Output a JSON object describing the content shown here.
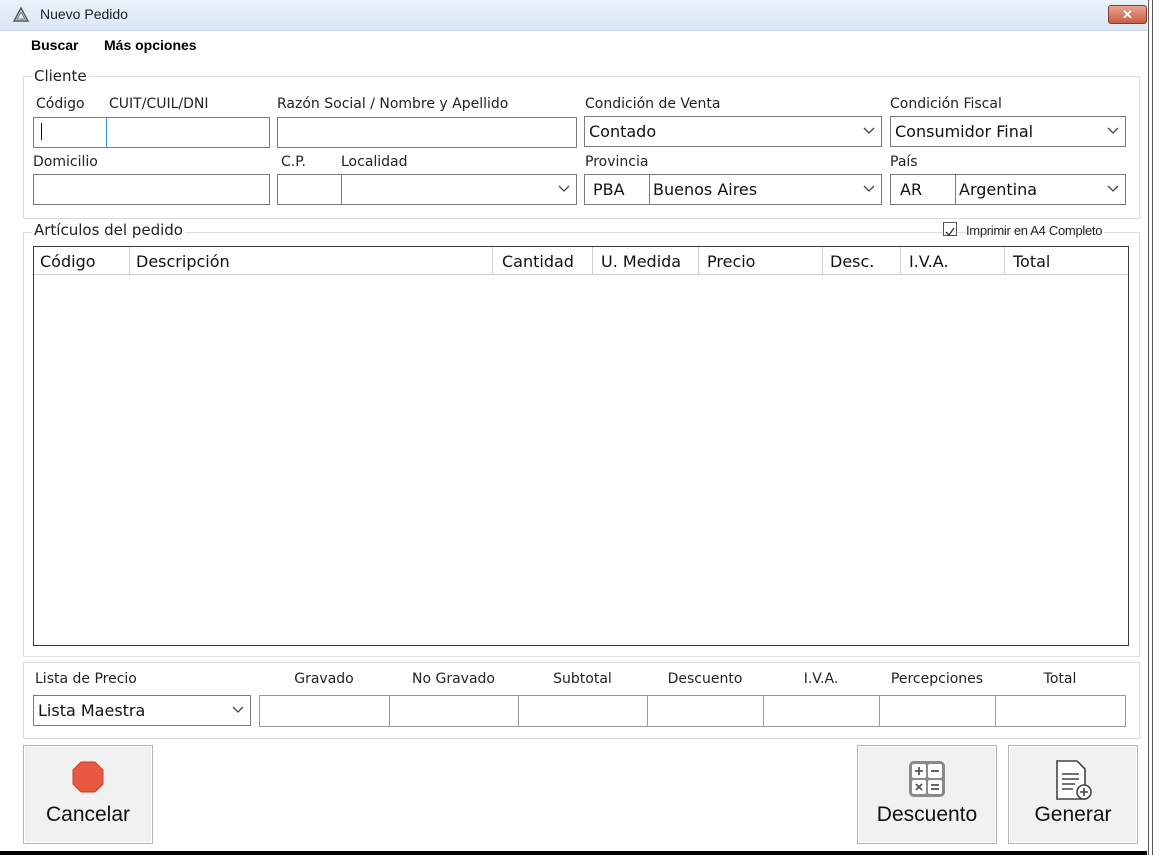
{
  "window": {
    "title": "Nuevo Pedido",
    "close_label": "✕"
  },
  "menu": {
    "buscar": "Buscar",
    "mas_opciones": "Más opciones"
  },
  "cliente": {
    "legend": "Cliente",
    "codigo_label": "Código",
    "cuit_label": "CUIT/CUIL/DNI",
    "razon_label": "Razón Social / Nombre y Apellido",
    "condicion_venta_label": "Condición de Venta",
    "condicion_venta_value": "Contado",
    "condicion_fiscal_label": "Condición Fiscal",
    "condicion_fiscal_value": "Consumidor Final",
    "domicilio_label": "Domicilio",
    "cp_label": "C.P.",
    "localidad_label": "Localidad",
    "provincia_label": "Provincia",
    "provincia_code": "PBA",
    "provincia_value": "Buenos Aires",
    "pais_label": "País",
    "pais_code": "AR",
    "pais_value": "Argentina"
  },
  "articulos": {
    "legend": "Artículos del pedido",
    "print_a4_label": "Imprimir en A4 Completo",
    "print_a4_checked": true,
    "columns": [
      "Código",
      "Descripción",
      "Cantidad",
      "U. Medida",
      "Precio",
      "Desc.",
      "I.V.A.",
      "Total"
    ],
    "rows": []
  },
  "totales": {
    "lista_precio_label": "Lista de Precio",
    "lista_precio_value": "Lista Maestra",
    "columns": [
      "Gravado",
      "No Gravado",
      "Subtotal",
      "Descuento",
      "I.V.A.",
      "Percepciones",
      "Total"
    ]
  },
  "buttons": {
    "cancelar": "Cancelar",
    "descuento": "Descuento",
    "generar": "Generar"
  },
  "colors": {
    "accent_focus": "#3a8ee6",
    "cancel_icon": "#e8573f",
    "titlebar": "#dae7f6"
  }
}
